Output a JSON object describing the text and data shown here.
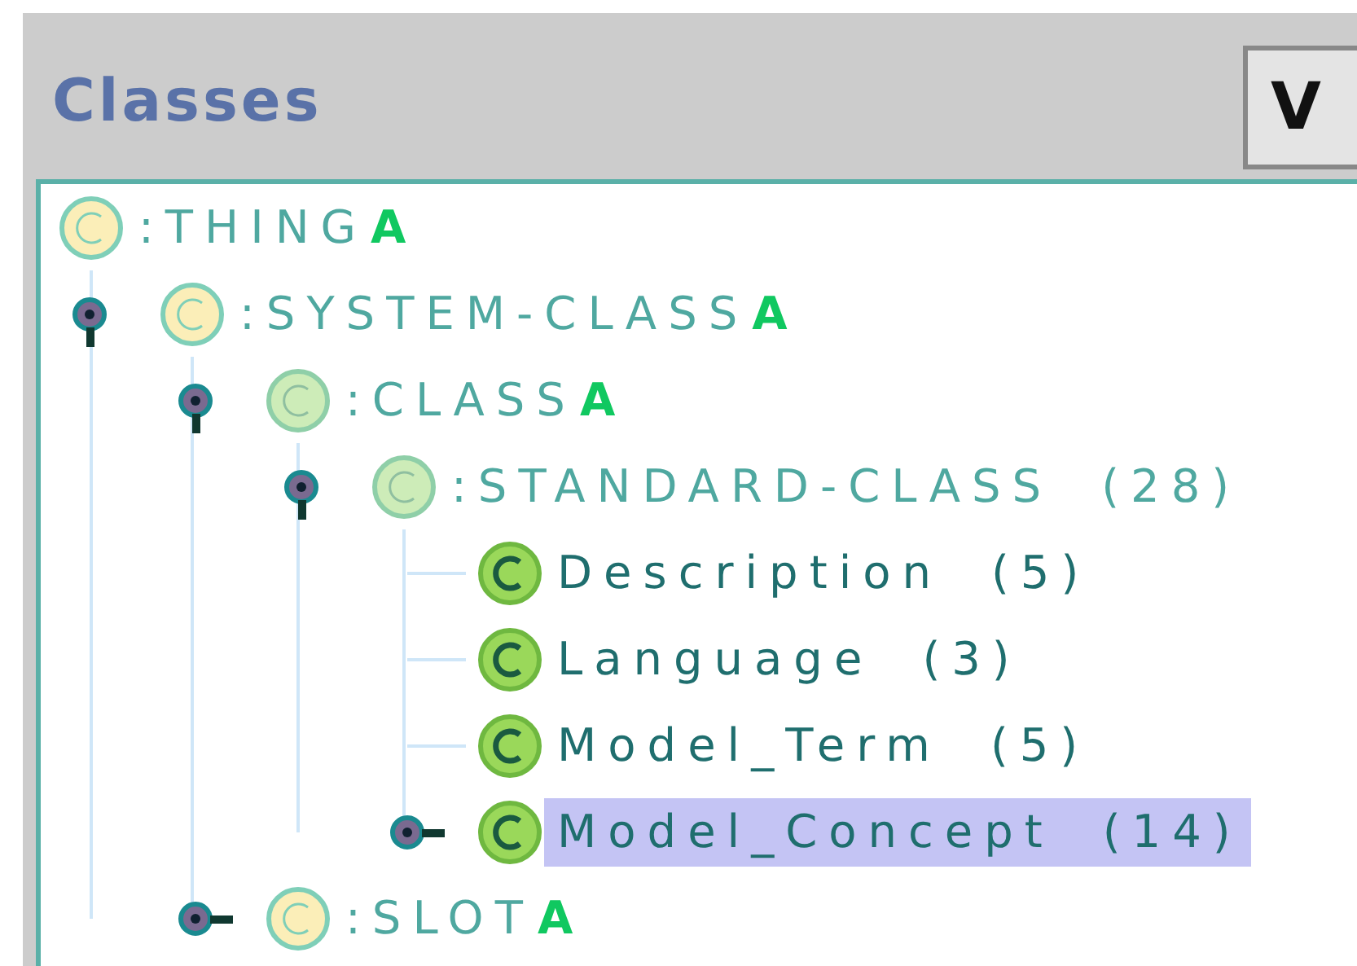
{
  "panel": {
    "title": "Classes",
    "button": "V"
  },
  "tree": [
    {
      "label": ":THING",
      "badge": "A",
      "kind": "system",
      "selected": false,
      "children": [
        {
          "label": ":SYSTEM-CLASS",
          "badge": "A",
          "kind": "system",
          "selected": false,
          "expanded": true,
          "children": [
            {
              "label": ":CLASS",
              "badge": "A",
              "kind": "meta",
              "selected": false,
              "expanded": true,
              "children": [
                {
                  "label": ":STANDARD-CLASS",
                  "count": "(28)",
                  "kind": "meta",
                  "selected": false,
                  "expanded": true,
                  "children": [
                    {
                      "label": "Description",
                      "count": "(5)",
                      "kind": "class",
                      "selected": false
                    },
                    {
                      "label": "Language",
                      "count": "(3)",
                      "kind": "class",
                      "selected": false
                    },
                    {
                      "label": "Model_Term",
                      "count": "(5)",
                      "kind": "class",
                      "selected": false
                    },
                    {
                      "label": "Model_Concept",
                      "count": "(14)",
                      "kind": "class",
                      "selected": true,
                      "expanded": false
                    }
                  ]
                }
              ]
            },
            {
              "label": ":SLOT",
              "badge": "A",
              "kind": "system",
              "selected": false,
              "expanded": false
            }
          ]
        }
      ]
    }
  ]
}
